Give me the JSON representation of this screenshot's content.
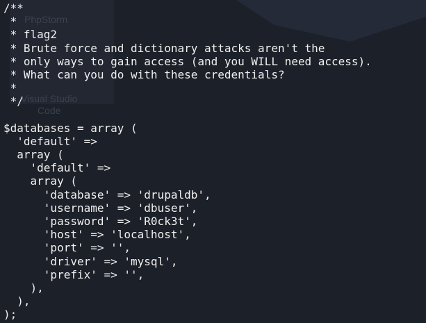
{
  "background_labels": {
    "app1": "PhpStorm",
    "app2_line1": "Visual Studio",
    "app2_line2": "Code"
  },
  "code_lines": [
    "/**",
    " *",
    " * flag2",
    " * Brute force and dictionary attacks aren't the",
    " * only ways to gain access (and you WILL need access).",
    " * What can you do with these credentials?",
    " *",
    " */",
    "",
    "$databases = array (",
    "  'default' =>",
    "  array (",
    "    'default' =>",
    "    array (",
    "      'database' => 'drupaldb',",
    "      'username' => 'dbuser',",
    "      'password' => 'R0ck3t',",
    "      'host' => 'localhost',",
    "      'port' => '',",
    "      'driver' => 'mysql',",
    "      'prefix' => '',",
    "    ),",
    "  ),",
    ");"
  ]
}
